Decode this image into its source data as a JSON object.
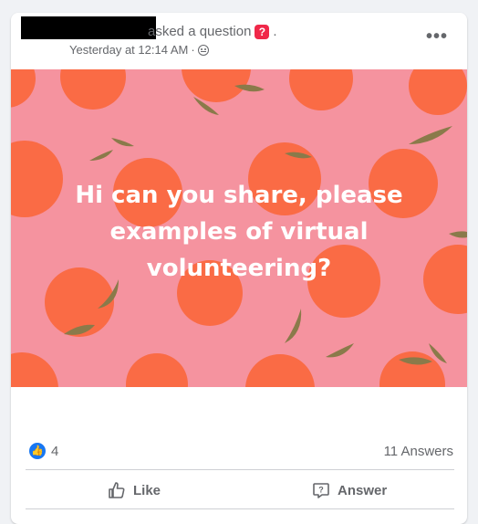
{
  "post": {
    "asked_text": "asked a question",
    "asked_suffix": ".",
    "question_icon": "question-icon",
    "timestamp": "Yesterday at 12:14 AM",
    "separator": "·",
    "privacy_icon": "globe-icon",
    "more_icon": "more-options-icon",
    "more_glyph": "•••"
  },
  "banner": {
    "question": "Hi can you share, please examples of virtual volunteering?",
    "background_color": "#f5939f",
    "fruit_color": "#fa6b45",
    "leaf_color": "#8a7a4a"
  },
  "stats": {
    "like_icon": "like-reaction-icon",
    "like_count": "4",
    "answers": "11 Answers"
  },
  "actions": {
    "like_label": "Like",
    "like_icon": "thumbs-up-icon",
    "answer_label": "Answer",
    "answer_icon": "answer-bubble-icon"
  },
  "colors": {
    "accent": "#1877f2",
    "question_red": "#f02849",
    "secondary_text": "#65676b"
  }
}
